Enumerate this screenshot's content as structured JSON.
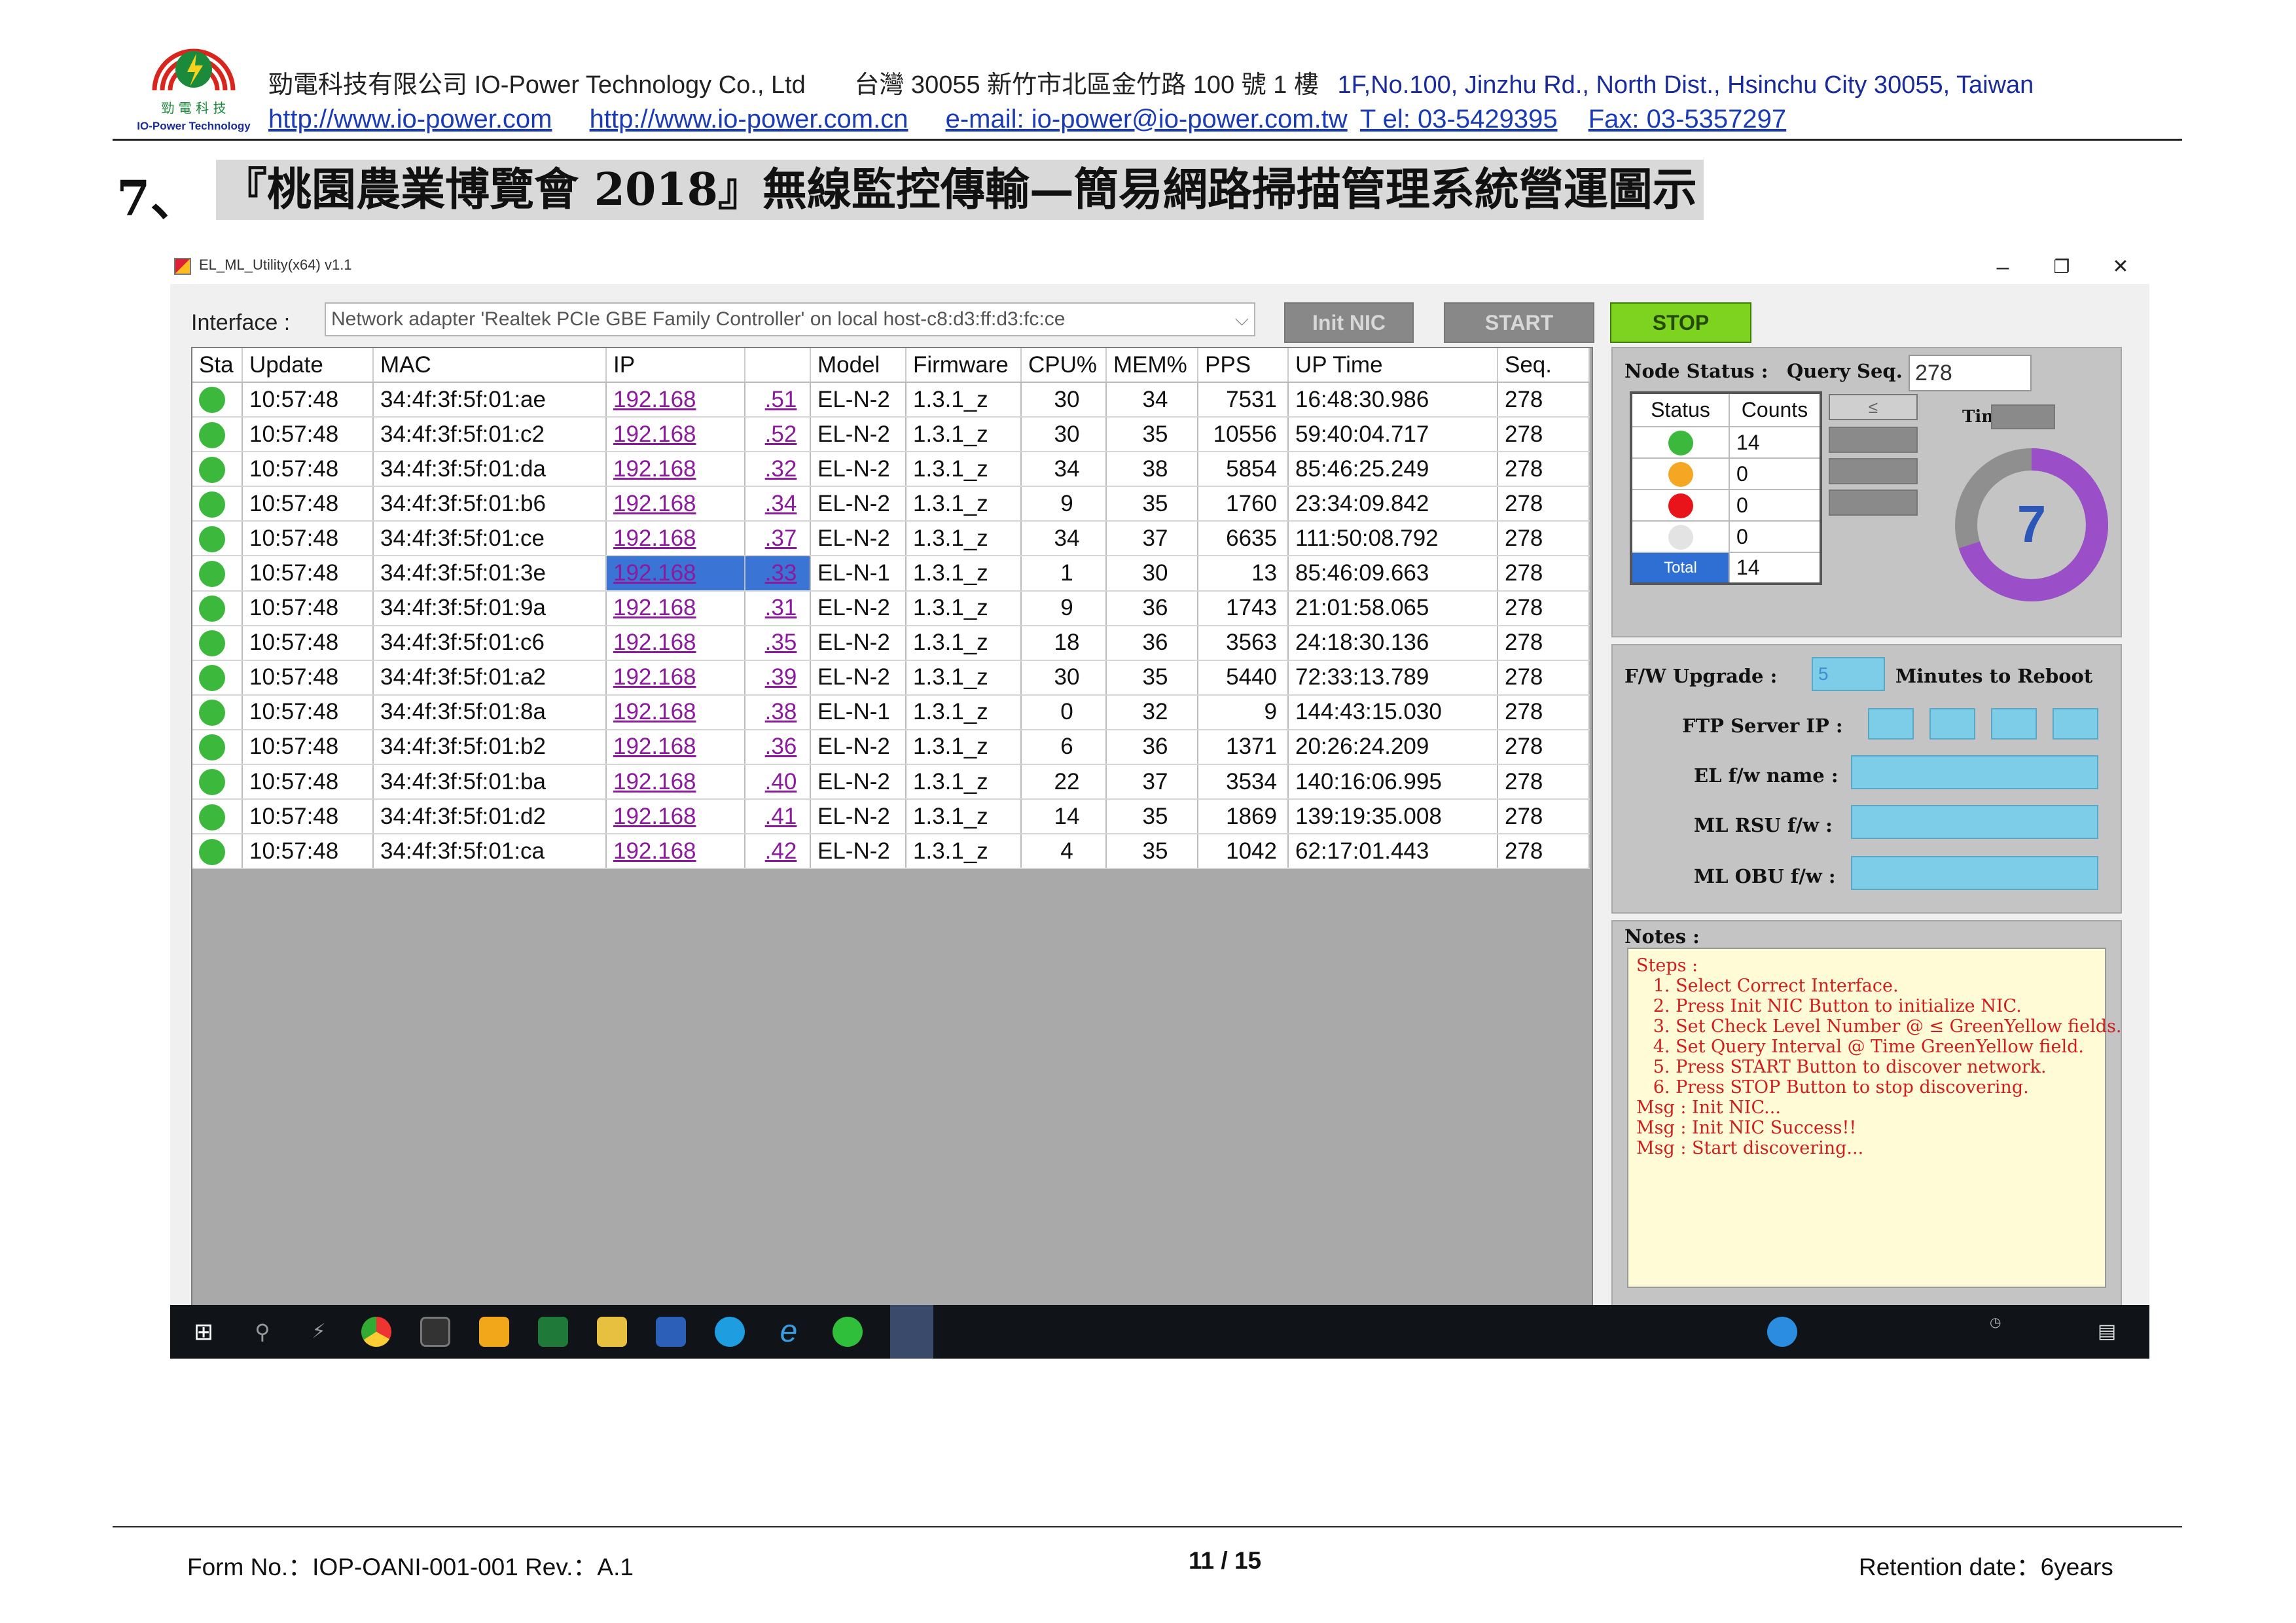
{
  "header": {
    "company_zh": "勁電科技有限公司",
    "company_en": "IO-Power Technology Co., Ltd",
    "address_zh": "台灣 30055 新竹市北區金竹路 100 號 1 樓",
    "address_en": "1F,No.100, Jinzhu Rd., North Dist., Hsinchu City 30055, Taiwan",
    "url1": "http://www.io-power.com",
    "url2": "http://www.io-power.com.cn",
    "email": "e-mail: io-power@io-power.com.tw",
    "tel": "T el: 03-5429395",
    "fax": "Fax: 03-5357297",
    "logo_text_zh": "勁 電 科 技",
    "logo_text_en": "IO-Power Technology"
  },
  "section": {
    "number": "7、",
    "title": "『桃園農業博覽會 2018』無線監控傳輸—簡易網路掃描管理系統營運圖示"
  },
  "app": {
    "title": "EL_ML_Utility(x64) v1.1",
    "interface_label": "Interface :",
    "interface_value": "Network adapter 'Realtek PCIe GBE Family Controller' on local host-c8:d3:ff:d3:fc:ce",
    "init_nic_label": "Init NIC",
    "start_label": "START",
    "stop_label": "STOP",
    "columns": [
      "Sta",
      "Update",
      "MAC",
      "IP",
      "",
      "Model",
      "Firmware",
      "CPU%",
      "MEM%",
      "PPS",
      "UP Time",
      "Seq."
    ],
    "rows": [
      {
        "update": "10:57:48",
        "mac": "34:4f:3f:5f:01:ae",
        "ip1": "192.168",
        "ip2": ".51",
        "model": "EL-N-2",
        "fw": "1.3.1_z",
        "cpu": "30",
        "mem": "34",
        "pps": "7531",
        "uptime": "16:48:30.986",
        "seq": "278"
      },
      {
        "update": "10:57:48",
        "mac": "34:4f:3f:5f:01:c2",
        "ip1": "192.168",
        "ip2": ".52",
        "model": "EL-N-2",
        "fw": "1.3.1_z",
        "cpu": "30",
        "mem": "35",
        "pps": "10556",
        "uptime": "59:40:04.717",
        "seq": "278"
      },
      {
        "update": "10:57:48",
        "mac": "34:4f:3f:5f:01:da",
        "ip1": "192.168",
        "ip2": ".32",
        "model": "EL-N-2",
        "fw": "1.3.1_z",
        "cpu": "34",
        "mem": "38",
        "pps": "5854",
        "uptime": "85:46:25.249",
        "seq": "278"
      },
      {
        "update": "10:57:48",
        "mac": "34:4f:3f:5f:01:b6",
        "ip1": "192.168",
        "ip2": ".34",
        "model": "EL-N-2",
        "fw": "1.3.1_z",
        "cpu": "9",
        "mem": "35",
        "pps": "1760",
        "uptime": "23:34:09.842",
        "seq": "278"
      },
      {
        "update": "10:57:48",
        "mac": "34:4f:3f:5f:01:ce",
        "ip1": "192.168",
        "ip2": ".37",
        "model": "EL-N-2",
        "fw": "1.3.1_z",
        "cpu": "34",
        "mem": "37",
        "pps": "6635",
        "uptime": "111:50:08.792",
        "seq": "278"
      },
      {
        "update": "10:57:48",
        "mac": "34:4f:3f:5f:01:3e",
        "ip1": "192.168",
        "ip2": ".33",
        "model": "EL-N-1",
        "fw": "1.3.1_z",
        "cpu": "1",
        "mem": "30",
        "pps": "13",
        "uptime": "85:46:09.663",
        "seq": "278"
      },
      {
        "update": "10:57:48",
        "mac": "34:4f:3f:5f:01:9a",
        "ip1": "192.168",
        "ip2": ".31",
        "model": "EL-N-2",
        "fw": "1.3.1_z",
        "cpu": "9",
        "mem": "36",
        "pps": "1743",
        "uptime": "21:01:58.065",
        "seq": "278"
      },
      {
        "update": "10:57:48",
        "mac": "34:4f:3f:5f:01:c6",
        "ip1": "192.168",
        "ip2": ".35",
        "model": "EL-N-2",
        "fw": "1.3.1_z",
        "cpu": "18",
        "mem": "36",
        "pps": "3563",
        "uptime": "24:18:30.136",
        "seq": "278"
      },
      {
        "update": "10:57:48",
        "mac": "34:4f:3f:5f:01:a2",
        "ip1": "192.168",
        "ip2": ".39",
        "model": "EL-N-2",
        "fw": "1.3.1_z",
        "cpu": "30",
        "mem": "35",
        "pps": "5440",
        "uptime": "72:33:13.789",
        "seq": "278"
      },
      {
        "update": "10:57:48",
        "mac": "34:4f:3f:5f:01:8a",
        "ip1": "192.168",
        "ip2": ".38",
        "model": "EL-N-1",
        "fw": "1.3.1_z",
        "cpu": "0",
        "mem": "32",
        "pps": "9",
        "uptime": "144:43:15.030",
        "seq": "278"
      },
      {
        "update": "10:57:48",
        "mac": "34:4f:3f:5f:01:b2",
        "ip1": "192.168",
        "ip2": ".36",
        "model": "EL-N-2",
        "fw": "1.3.1_z",
        "cpu": "6",
        "mem": "36",
        "pps": "1371",
        "uptime": "20:26:24.209",
        "seq": "278"
      },
      {
        "update": "10:57:48",
        "mac": "34:4f:3f:5f:01:ba",
        "ip1": "192.168",
        "ip2": ".40",
        "model": "EL-N-2",
        "fw": "1.3.1_z",
        "cpu": "22",
        "mem": "37",
        "pps": "3534",
        "uptime": "140:16:06.995",
        "seq": "278"
      },
      {
        "update": "10:57:48",
        "mac": "34:4f:3f:5f:01:d2",
        "ip1": "192.168",
        "ip2": ".41",
        "model": "EL-N-2",
        "fw": "1.3.1_z",
        "cpu": "14",
        "mem": "35",
        "pps": "1869",
        "uptime": "139:19:35.008",
        "seq": "278"
      },
      {
        "update": "10:57:48",
        "mac": "34:4f:3f:5f:01:ca",
        "ip1": "192.168",
        "ip2": ".42",
        "model": "EL-N-2",
        "fw": "1.3.1_z",
        "cpu": "4",
        "mem": "35",
        "pps": "1042",
        "uptime": "62:17:01.443",
        "seq": "278"
      }
    ],
    "node_status_label": "Node Status :",
    "query_seq_label": "Query Seq. :",
    "query_seq_value": "278",
    "status_col": "Status",
    "counts_col": "Counts",
    "status_rows": [
      {
        "color": "#3cb93c",
        "count": "14"
      },
      {
        "color": "#f5a623",
        "count": "0"
      },
      {
        "color": "#e8141a",
        "count": "0"
      },
      {
        "color": "#e3e3e3",
        "count": "0"
      }
    ],
    "total_label": "Total",
    "total_count": "14",
    "le_symbol": "≤",
    "time_label": "Time :",
    "donut_value": "7",
    "donut_fraction": 0.7,
    "fw_upgrade_label": "F/W Upgrade :",
    "fw_upgrade_value": "5",
    "minutes_label": "Minutes to Reboot",
    "ftp_label": "FTP Server IP :",
    "el_fw_label": "EL f/w name :",
    "ml_rsu_label": "ML RSU f/w :",
    "ml_obu_label": "ML OBU f/w :",
    "notes_label": "Notes :",
    "notes_text": "Steps :\n   1. Select Correct Interface.\n   2. Press Init NIC Button to initialize NIC.\n   3. Set Check Level Number @ ≤ GreenYellow fields.\n   4. Set Query Interval @ Time GreenYellow field.\n   5. Press START Button to discover network.\n   6. Press STOP Button to stop discovering.\nMsg : Init NIC...\nMsg : Init NIC Success!!\nMsg : Start discovering..."
  },
  "footer": {
    "form_no": "Form No.：IOP-OANI-001-001    Rev.：A.1",
    "page": "11 / 15",
    "retention": "Retention date：6years"
  }
}
